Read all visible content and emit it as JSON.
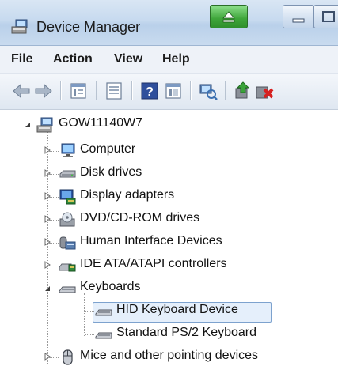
{
  "window": {
    "title": "Device Manager",
    "icons": {
      "title": "device-manager-icon",
      "minimize": "minimize-icon",
      "maximize": "maximize-icon",
      "green_button": "eject-icon"
    }
  },
  "menu": {
    "items": [
      "File",
      "Action",
      "View",
      "Help"
    ]
  },
  "toolbar": {
    "buttons": [
      "back-arrow-icon",
      "forward-arrow-icon",
      "properties-icon",
      "show-hide-console-tree-icon",
      "help-icon",
      "view-icon",
      "scan-hardware-icon",
      "update-driver-icon",
      "uninstall-icon"
    ]
  },
  "tree": {
    "root": {
      "label": "GOW11140W7",
      "icon": "computer-root-icon",
      "expanded": true
    },
    "categories": [
      {
        "label": "Computer",
        "icon": "computer-icon",
        "expanded": false
      },
      {
        "label": "Disk drives",
        "icon": "disk-drive-icon",
        "expanded": false
      },
      {
        "label": "Display adapters",
        "icon": "display-adapter-icon",
        "expanded": false
      },
      {
        "label": "DVD/CD-ROM drives",
        "icon": "dvd-drive-icon",
        "expanded": false
      },
      {
        "label": "Human Interface Devices",
        "icon": "hid-icon",
        "expanded": false
      },
      {
        "label": "IDE ATA/ATAPI controllers",
        "icon": "ide-controller-icon",
        "expanded": false
      },
      {
        "label": "Keyboards",
        "icon": "keyboard-icon",
        "expanded": true
      },
      {
        "label": "Mice and other pointing devices",
        "icon": "mouse-icon",
        "expanded": false
      }
    ],
    "keyboard_children": [
      {
        "label": "HID Keyboard Device",
        "icon": "keyboard-icon",
        "selected": true
      },
      {
        "label": "Standard PS/2 Keyboard",
        "icon": "keyboard-icon",
        "selected": false
      }
    ]
  },
  "colors": {
    "titlebar": "#c7daef",
    "selection_border": "#7da2ce",
    "selection_fill": "#e5effb",
    "green_button": "#3ea53a"
  }
}
